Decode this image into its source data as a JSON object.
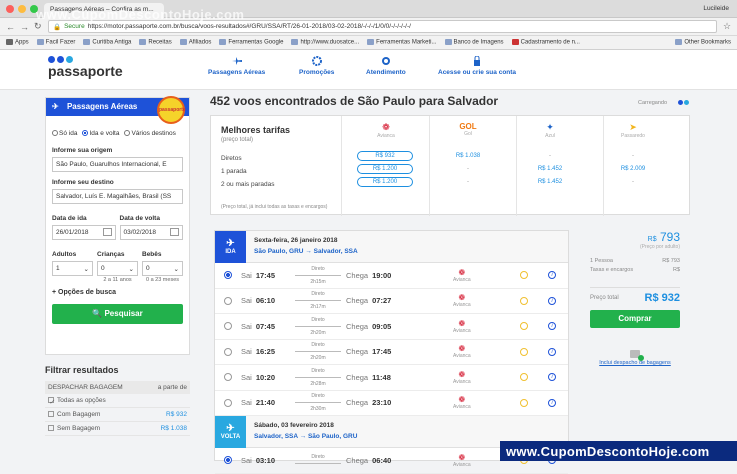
{
  "browser": {
    "tab_title": "Passagens Aéreas – Confira as m...",
    "user": "Lucileide",
    "secure_label": "Secure",
    "url": "https://motor.passaporte.com.br/busca/voos-resultados#/GRU/SSA/RT/26-01-2018/03-02-2018/-/-/-/1/0/0/-/-/-/-/-/",
    "watermark_top": "www.CupomDescontoHoje.com",
    "bookmarks": [
      "Apps",
      "Facil Fazer",
      "Curitiba Antiga",
      "Receitas",
      "Afiliados",
      "Ferramentas Google",
      "http://www.duosatce...",
      "Ferramentas Marketi...",
      "Banco de Imagens",
      "Cadastramento de n...",
      "Other Bookmarks"
    ]
  },
  "header": {
    "logo": "passaporte",
    "nav": [
      "Passagens Aéreas",
      "Promoções",
      "Atendimento",
      "Acesse ou crie sua conta"
    ]
  },
  "search": {
    "title": "Passagens Aéreas",
    "sticker": "passaporte",
    "trip_types": [
      "Só ida",
      "Ida e volta",
      "Vários destinos"
    ],
    "origin_label": "Informe sua origem",
    "origin_value": "São Paulo, Guarulhos Internacional, E",
    "dest_label": "Informe seu destino",
    "dest_value": "Salvador, Luís E. Magalhães, Brasil (SS",
    "depart_label": "Data de ida",
    "depart_value": "26/01/2018",
    "return_label": "Data de volta",
    "return_value": "03/02/2018",
    "adults_label": "Adultos",
    "adults_value": "1",
    "children_label": "Crianças",
    "children_value": "0",
    "children_hint": "2 a 11 anos",
    "babies_label": "Bebês",
    "babies_value": "0",
    "babies_hint": "0 a 23 meses",
    "options_label": "+ Opções de busca",
    "button": "Pesquisar"
  },
  "filters": {
    "title": "Filtrar resultados",
    "section": "DESPACHAR BAGAGEM",
    "section_right": "a parte de",
    "options": [
      {
        "label": "Todas as opções",
        "price": ""
      },
      {
        "label": "Com Bagagem",
        "price": "R$ 932"
      },
      {
        "label": "Sem Bagagem",
        "price": "R$ 1.038"
      }
    ]
  },
  "results": {
    "title": "452 voos encontrados de São Paulo para Salvador",
    "loading": "Carregando"
  },
  "best_fares": {
    "title": "Melhores tarifas",
    "subtitle": "(preço total)",
    "rows": [
      "Diretos",
      "1 parada",
      "2 ou mais paradas"
    ],
    "airlines": [
      "Avianca",
      "Gol",
      "Azul",
      "Passaredo"
    ],
    "avianca": [
      "R$ 932",
      "R$ 1.200",
      "R$ 1.200"
    ],
    "gol": [
      "R$ 1.038",
      "-",
      "-"
    ],
    "azul": [
      "-",
      "R$ 1.452",
      "R$ 1.452"
    ],
    "passaredo": [
      "-",
      "R$ 2.009",
      "-"
    ],
    "note": "(Preço total, já inclui todas as taxas e encargos)"
  },
  "outbound": {
    "badge": "IDA",
    "date": "Sexta-feira, 26 janeiro 2018",
    "origin": "São Paulo, GRU",
    "arrow": "→",
    "dest": "Salvador, SSA",
    "flights": [
      {
        "sai": "17:45",
        "dur": "2h15m",
        "chega": "19:00"
      },
      {
        "sai": "06:10",
        "dur": "2h17m",
        "chega": "07:27"
      },
      {
        "sai": "07:45",
        "dur": "2h20m",
        "chega": "09:05"
      },
      {
        "sai": "16:25",
        "dur": "2h20m",
        "chega": "17:45"
      },
      {
        "sai": "10:20",
        "dur": "2h28m",
        "chega": "11:48"
      },
      {
        "sai": "21:40",
        "dur": "2h30m",
        "chega": "23:10"
      }
    ]
  },
  "inbound": {
    "badge": "VOLTA",
    "date": "Sábado, 03 fevereiro 2018",
    "origin": "Salvador, SSA",
    "arrow": "→",
    "dest": "São Paulo, GRU",
    "flights": [
      {
        "sai": "03:10",
        "dur": "",
        "chega": "06:40"
      }
    ]
  },
  "flight_labels": {
    "sai": "Sai",
    "chega": "Chega",
    "direto": "Direto",
    "airline": "Avianca"
  },
  "price": {
    "currency": "R$",
    "per_person": "793",
    "per_person_note": "(Preço por adulto)",
    "line1_label": "1 Pessoa",
    "line1_value": "R$ 793",
    "line2_label": "Taxas e encargos",
    "line2_value": "R$",
    "total_label": "Preço total",
    "total_value": "R$ 932",
    "button": "Comprar",
    "baggage_link": "Inclui despacho de bagagens"
  },
  "watermark_bottom": "www.CupomDescontoHoje.com",
  "colors": {
    "brand_blue": "#1e52d8",
    "green": "#22b14c",
    "price_blue": "#1d8fe0",
    "avianca_red": "#d0021b"
  }
}
